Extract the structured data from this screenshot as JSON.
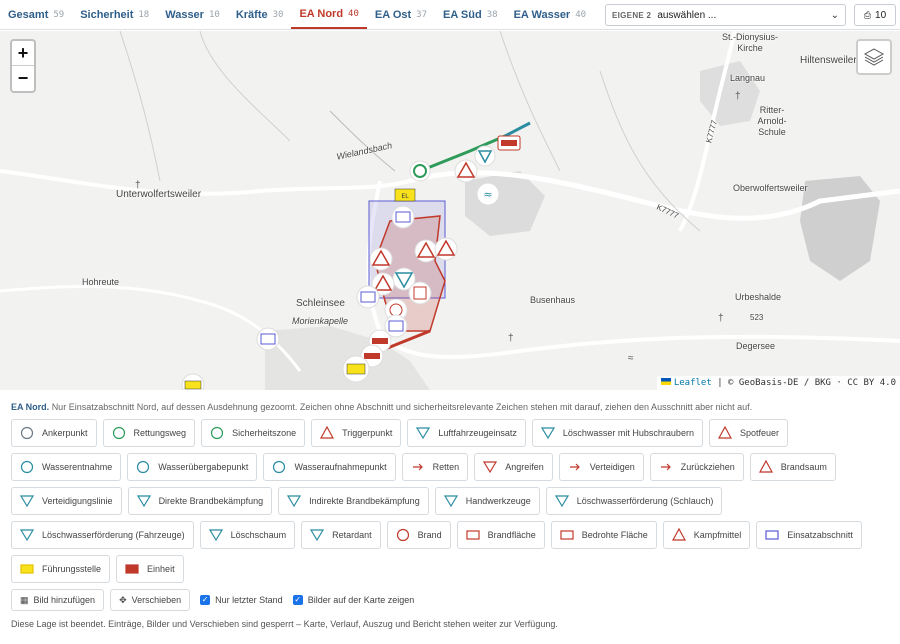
{
  "tabs": [
    {
      "label": "Gesamt",
      "count": "59"
    },
    {
      "label": "Sicherheit",
      "count": "18"
    },
    {
      "label": "Wasser",
      "count": "10"
    },
    {
      "label": "Kräfte",
      "count": "30"
    },
    {
      "label": "EA Nord",
      "count": "40"
    },
    {
      "label": "EA Ost",
      "count": "37"
    },
    {
      "label": "EA Süd",
      "count": "38"
    },
    {
      "label": "EA Wasser",
      "count": "40"
    }
  ],
  "eigene": {
    "label": "EIGENE 2",
    "selected": "auswählen ..."
  },
  "print_count": "10",
  "map": {
    "zoom_in": "+",
    "zoom_out": "−",
    "labels": {
      "unterwolf": "Unterwolfertsweiler",
      "hohreute": "Hohreute",
      "schleinsee": "Schleinsee",
      "morienkapelle": "Morienkapelle",
      "busenhaus": "Busenhaus",
      "oberwolf": "Oberwolfertsweiler",
      "urbeshalde": "Urbeshalde",
      "degersee": "Degersee",
      "langnau": "Langnau",
      "hiltensweiler": "Hiltensweiler",
      "kirche": "St.-Dionysius-Kirche",
      "ritter": "Ritter-Arnold-Schule",
      "wielandsbach": "Wielandsbach",
      "k7777a": "K7777",
      "k7777b": "K7777",
      "h523": "523"
    },
    "attribution": {
      "leaflet": "Leaflet",
      "rest": "| © GeoBasis-DE / BKG · CC BY 4.0"
    }
  },
  "panel": {
    "info_title": "EA Nord.",
    "info_text": "Nur Einsatzabschnitt Nord, auf dessen Ausdehnung gezoomt. Zeichen ohne Abschnitt und sicherheitsrelevante Zeichen stehen mit darauf, ziehen den Ausschnitt aber nicht auf.",
    "rows": [
      [
        {
          "label": "Ankerpunkt",
          "icon": "anchor-icon",
          "color": "#6b7a86"
        },
        {
          "label": "Rettungsweg",
          "icon": "route-icon",
          "color": "#2e9b5a"
        },
        {
          "label": "Sicherheitszone",
          "icon": "zone-icon",
          "color": "#2e9b5a"
        },
        {
          "label": "Triggerpunkt",
          "icon": "trigger-icon",
          "color": "#c0392b"
        },
        {
          "label": "Luftfahrzeugeinsatz",
          "icon": "aircraft-icon",
          "color": "#2a8ca0"
        },
        {
          "label": "Löschwasser mit Hubschraubern",
          "icon": "heli-water-icon",
          "color": "#2a8ca0"
        },
        {
          "label": "Spotfeuer",
          "icon": "spotfire-icon",
          "color": "#c0392b"
        }
      ],
      [
        {
          "label": "Wasserentnahme",
          "icon": "water-intake-icon",
          "color": "#2a8ca0"
        },
        {
          "label": "Wasserübergabepunkt",
          "icon": "water-handover-icon",
          "color": "#2a8ca0"
        },
        {
          "label": "Wasseraufnahmepunkt",
          "icon": "water-pickup-icon",
          "color": "#2a8ca0"
        },
        {
          "label": "Retten",
          "icon": "rescue-icon",
          "color": "#c0392b"
        },
        {
          "label": "Angreifen",
          "icon": "attack-icon",
          "color": "#c0392b"
        },
        {
          "label": "Verteidigen",
          "icon": "defend-icon",
          "color": "#c0392b"
        },
        {
          "label": "Zurückziehen",
          "icon": "retreat-icon",
          "color": "#c0392b"
        },
        {
          "label": "Brandsaum",
          "icon": "fire-edge-icon",
          "color": "#c0392b"
        }
      ],
      [
        {
          "label": "Verteidigungslinie",
          "icon": "defense-line-icon",
          "color": "#2a8ca0"
        },
        {
          "label": "Direkte Brandbekämpfung",
          "icon": "direct-attack-icon",
          "color": "#2a8ca0"
        },
        {
          "label": "Indirekte Brandbekämpfung",
          "icon": "indirect-attack-icon",
          "color": "#2a8ca0"
        },
        {
          "label": "Handwerkzeuge",
          "icon": "handtools-icon",
          "color": "#2a8ca0"
        },
        {
          "label": "Löschwasserförderung (Schlauch)",
          "icon": "hose-icon",
          "color": "#2a8ca0"
        }
      ],
      [
        {
          "label": "Löschwasserförderung (Fahrzeuge)",
          "icon": "tanker-icon",
          "color": "#2a8ca0"
        },
        {
          "label": "Löschschaum",
          "icon": "foam-icon",
          "color": "#2a8ca0"
        },
        {
          "label": "Retardant",
          "icon": "retardant-icon",
          "color": "#2a8ca0"
        },
        {
          "label": "Brand",
          "icon": "fire-icon",
          "color": "#c0392b"
        },
        {
          "label": "Brandfläche",
          "icon": "fire-area-icon",
          "color": "#c0392b"
        },
        {
          "label": "Bedrohte Fläche",
          "icon": "threat-area-icon",
          "color": "#c0392b"
        },
        {
          "label": "Kampfmittel",
          "icon": "ordnance-icon",
          "color": "#c0392b"
        },
        {
          "label": "Einsatzabschnitt",
          "icon": "sector-icon",
          "color": "#5b5bd6"
        }
      ],
      [
        {
          "label": "Führungsstelle",
          "icon": "command-post-icon",
          "color": "#e6c200"
        },
        {
          "label": "Einheit",
          "icon": "unit-icon",
          "color": "#c0392b"
        }
      ]
    ],
    "add_image": "Bild hinzufügen",
    "move": "Verschieben",
    "only_last": "Nur letzter Stand",
    "show_images": "Bilder auf der Karte zeigen",
    "note": "Diese Lage ist beendet. Einträge, Bilder und Verschieben sind gesperrt – Karte, Verlauf, Auszug und Bericht stehen weiter zur Verfügung."
  }
}
